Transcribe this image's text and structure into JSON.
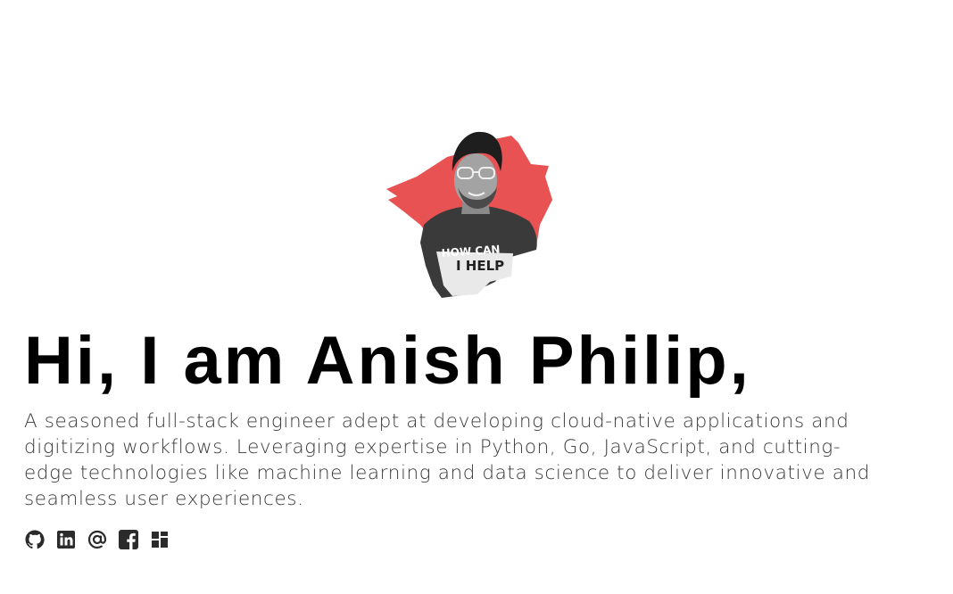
{
  "hero": {
    "headline": "Hi, I am Anish Philip,",
    "bio": "A seasoned full-stack engineer adept at developing cloud-native applications and digitizing workflows. Leveraging expertise in Python, Go, JavaScript, and cutting-edge technologies like machine learning and data science to deliver innovative and seamless user experiences.",
    "avatar": {
      "shirt_text_line1": "HOW CAN",
      "shirt_text_line2": "I HELP",
      "splash_color": "#e85252"
    }
  },
  "social": {
    "links": [
      {
        "icon": "github-icon"
      },
      {
        "icon": "linkedin-icon"
      },
      {
        "icon": "at-icon"
      },
      {
        "icon": "facebook-icon"
      },
      {
        "icon": "blog-icon"
      }
    ]
  },
  "colors": {
    "background": "#ffffff",
    "headline": "#000000",
    "bio_text": "#3a3a3a",
    "icon": "#2b2b2b",
    "accent": "#e85252"
  }
}
